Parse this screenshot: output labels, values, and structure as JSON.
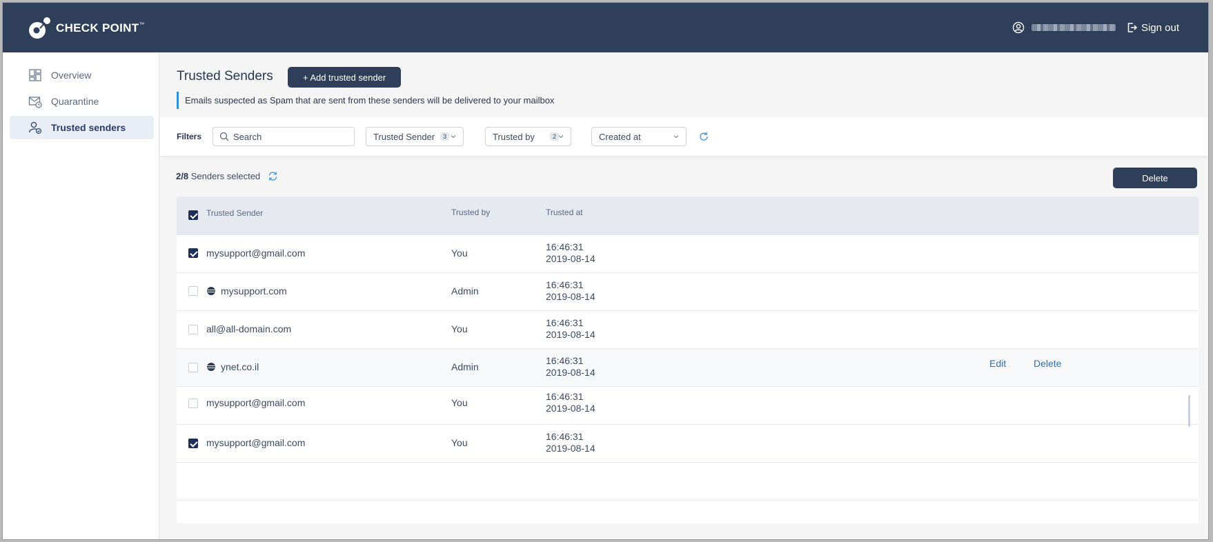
{
  "brand": {
    "name": "CHECK POINT",
    "tm": "™"
  },
  "user": {
    "signout_label": "Sign out"
  },
  "sidebar": {
    "items": [
      {
        "label": "Overview",
        "icon": "dashboard-icon"
      },
      {
        "label": "Quarantine",
        "icon": "mail-quarantine-icon"
      },
      {
        "label": "Trusted senders",
        "icon": "trusted-user-icon",
        "active": true
      }
    ]
  },
  "header": {
    "title": "Trusted Senders",
    "add_button": "+ Add trusted sender",
    "info": "Emails suspected as Spam that are sent from these senders will be delivered to your mailbox"
  },
  "filters": {
    "label": "Filters",
    "search_placeholder": "Search",
    "trusted_sender": {
      "label": "Trusted Sender",
      "count": "3"
    },
    "trusted_by": {
      "label": "Trusted by",
      "count": "2"
    },
    "created_at": {
      "label": "Created at"
    }
  },
  "selection": {
    "count": "2/8",
    "text": "Senders selected",
    "delete_label": "Delete"
  },
  "table": {
    "columns": [
      "Trusted Sender",
      "Trusted by",
      "Trusted at"
    ],
    "rows": [
      {
        "sender": "mysupport@gmail.com",
        "by": "You",
        "time": "16:46:31",
        "date": "2019-08-14",
        "checked": true,
        "domain": false
      },
      {
        "sender": "mysupport.com",
        "by": "Admin",
        "time": "16:46:31",
        "date": "2019-08-14",
        "checked": false,
        "domain": true
      },
      {
        "sender": "all@all-domain.com",
        "by": "You",
        "time": "16:46:31",
        "date": "2019-08-14",
        "checked": false,
        "domain": false
      },
      {
        "sender": "ynet.co.il",
        "by": "Admin",
        "time": "16:46:31",
        "date": "2019-08-14",
        "checked": false,
        "domain": true,
        "actions": {
          "edit": "Edit",
          "delete": "Delete"
        }
      },
      {
        "sender": "mysupport@gmail.com",
        "by": "You",
        "time": "16:46:31",
        "date": "2019-08-14",
        "checked": false,
        "domain": false
      },
      {
        "sender": "mysupport@gmail.com",
        "by": "You",
        "time": "16:46:31",
        "date": "2019-08-14",
        "checked": true,
        "domain": false
      }
    ]
  },
  "colors": {
    "topbar": "#2f3f59",
    "accent": "#2f8fd8",
    "link": "#2d6fb6"
  }
}
